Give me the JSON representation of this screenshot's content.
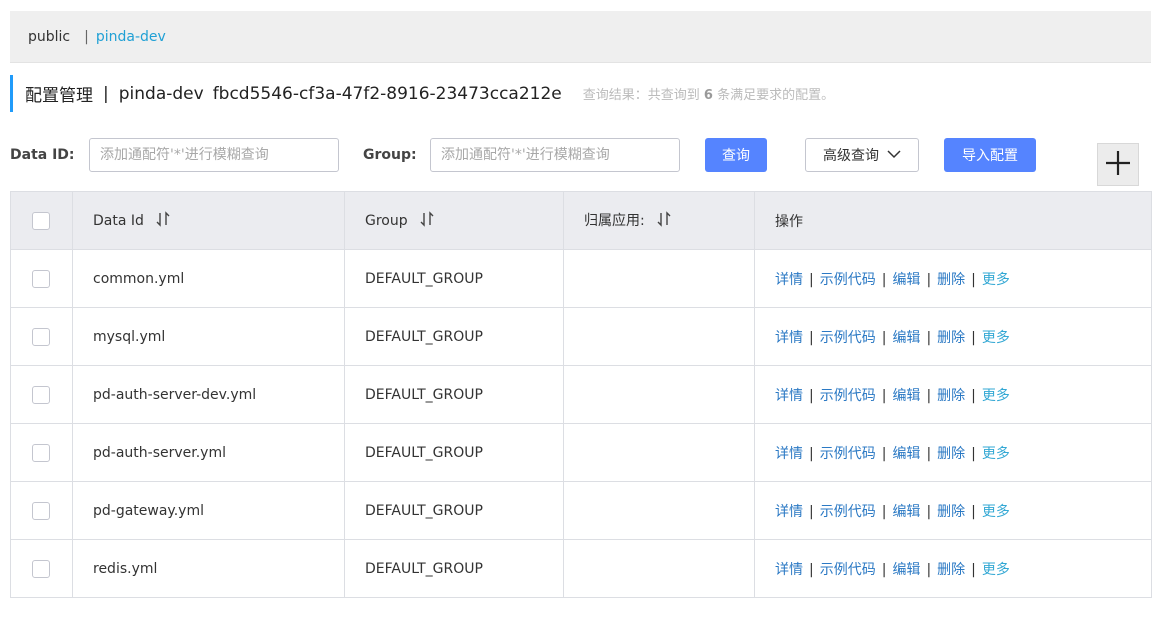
{
  "namespace_bar": {
    "public": "public",
    "separator": "|",
    "current": "pinda-dev"
  },
  "header": {
    "title": "配置管理",
    "separator": "|",
    "namespace": "pinda-dev",
    "namespace_id": "fbcd5546-cf3a-47f2-8916-23473cca212e",
    "result_prefix": "查询结果：共查询到",
    "result_count": "6",
    "result_suffix": "条满足要求的配置。"
  },
  "search": {
    "data_id_label": "Data ID:",
    "data_id_placeholder": "添加通配符'*'进行模糊查询",
    "group_label": "Group:",
    "group_placeholder": "添加通配符'*'进行模糊查询",
    "query_button": "查询",
    "advanced_button": "高级查询",
    "import_button": "导入配置"
  },
  "table": {
    "columns": {
      "data_id": "Data Id",
      "group": "Group",
      "app": "归属应用:",
      "ops": "操作"
    },
    "actions": {
      "detail": "详情",
      "sample": "示例代码",
      "edit": "编辑",
      "delete": "删除",
      "more": "更多"
    },
    "rows": [
      {
        "data_id": "common.yml",
        "group": "DEFAULT_GROUP",
        "app": ""
      },
      {
        "data_id": "mysql.yml",
        "group": "DEFAULT_GROUP",
        "app": ""
      },
      {
        "data_id": "pd-auth-server-dev.yml",
        "group": "DEFAULT_GROUP",
        "app": ""
      },
      {
        "data_id": "pd-auth-server.yml",
        "group": "DEFAULT_GROUP",
        "app": ""
      },
      {
        "data_id": "pd-gateway.yml",
        "group": "DEFAULT_GROUP",
        "app": ""
      },
      {
        "data_id": "redis.yml",
        "group": "DEFAULT_GROUP",
        "app": ""
      }
    ]
  },
  "colors": {
    "accent": "#5584ff",
    "link": "#2b79c4",
    "more_link": "#33a8d4",
    "namespace_active": "#20a0d5"
  }
}
